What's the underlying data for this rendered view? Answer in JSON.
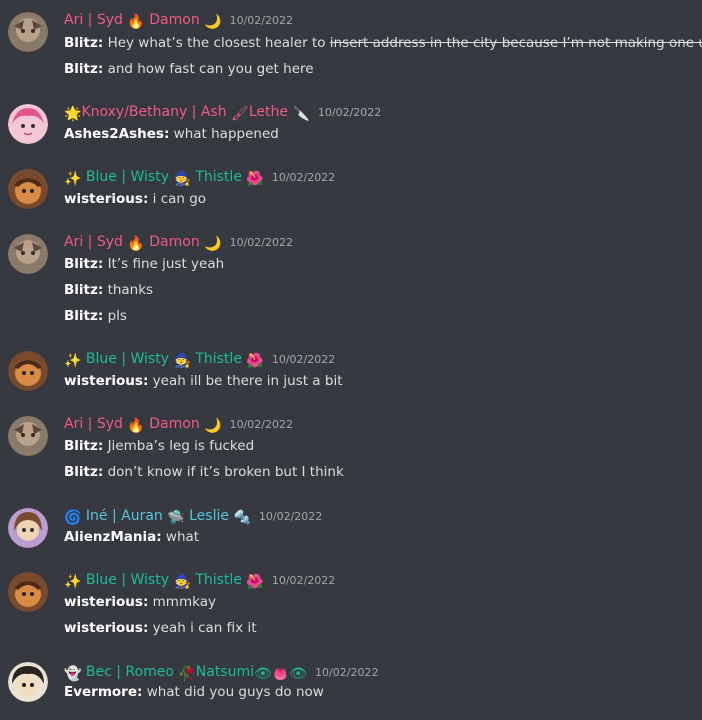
{
  "colors": {
    "background": "#36393f",
    "pink_name": "#f05a84",
    "teal_name": "#1abc9c",
    "cyan_name": "#56c6d8",
    "timestamp": "#a3a6aa",
    "text": "#dcddde"
  },
  "messages": [
    {
      "name_parts": [
        "Ari | Syd",
        "Damon"
      ],
      "name_emojis": [
        "🔥",
        "🌙"
      ],
      "timestamp": "10/02/2022",
      "lines": [
        {
          "author": "Blitz:",
          "text": "Hey what’s the closest healer to ",
          "struck": "insert address in the city because I’m not making one up"
        },
        {
          "author": "Blitz:",
          "text": "and how fast can you get here"
        }
      ]
    },
    {
      "name_parts": [
        "Knoxy/Bethany | Ash",
        "Lethe"
      ],
      "name_emojis": [
        "🌟",
        "🖌",
        "🔪"
      ],
      "timestamp": "10/02/2022",
      "lines": [
        {
          "author": "Ashes2Ashes:",
          "text": "what happened"
        }
      ]
    },
    {
      "name_parts": [
        "Blue | Wisty",
        "Thistle"
      ],
      "name_emojis": [
        "✨",
        "🧙",
        "🌺"
      ],
      "timestamp": "10/02/2022",
      "lines": [
        {
          "author": "wisterious:",
          "text": "i can go"
        }
      ]
    },
    {
      "name_parts": [
        "Ari | Syd",
        "Damon"
      ],
      "name_emojis": [
        "🔥",
        "🌙"
      ],
      "timestamp": "10/02/2022",
      "lines": [
        {
          "author": "Blitz:",
          "text": "It’s fine just yeah"
        },
        {
          "author": "Blitz:",
          "text": "thanks"
        },
        {
          "author": "Blitz:",
          "text": "pls"
        }
      ]
    },
    {
      "name_parts": [
        "Blue | Wisty",
        "Thistle"
      ],
      "name_emojis": [
        "✨",
        "🧙",
        "🌺"
      ],
      "timestamp": "10/02/2022",
      "lines": [
        {
          "author": "wisterious:",
          "text": "yeah ill be there in just a bit"
        }
      ]
    },
    {
      "name_parts": [
        "Ari | Syd",
        "Damon"
      ],
      "name_emojis": [
        "🔥",
        "🌙"
      ],
      "timestamp": "10/02/2022",
      "lines": [
        {
          "author": "Blitz:",
          "text": "Jiemba’s leg is fucked"
        },
        {
          "author": "Blitz:",
          "text": "don’t know if it’s broken but I think"
        }
      ]
    },
    {
      "name_parts": [
        "Iné | Auran",
        "Leslie"
      ],
      "name_emojis": [
        "🌀",
        "🛸",
        "🔩"
      ],
      "timestamp": "10/02/2022",
      "lines": [
        {
          "author": "AlienzMania:",
          "text": "what"
        }
      ]
    },
    {
      "name_parts": [
        "Blue | Wisty",
        "Thistle"
      ],
      "name_emojis": [
        "✨",
        "🧙",
        "🌺"
      ],
      "timestamp": "10/02/2022",
      "lines": [
        {
          "author": "wisterious:",
          "text": "mmmkay"
        },
        {
          "author": "wisterious:",
          "text": "yeah i can fix it"
        }
      ]
    },
    {
      "name_parts": [
        "Bec | Romeo",
        "Natsumi"
      ],
      "name_emojis": [
        "👻",
        "🥀",
        "👁",
        "👅",
        "👁"
      ],
      "timestamp": "10/02/2022",
      "lines": [
        {
          "author": "Evermore:",
          "text": "what did you guys do now"
        }
      ]
    }
  ]
}
